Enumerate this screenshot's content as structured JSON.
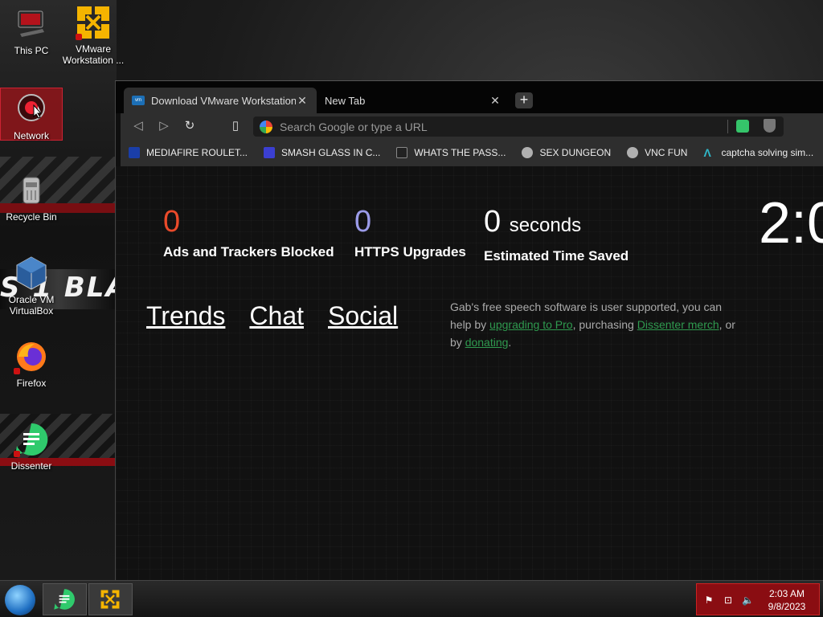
{
  "desktop": {
    "icons": [
      {
        "label": "This PC"
      },
      {
        "label": "VMware Workstation ..."
      },
      {
        "label": "Network"
      },
      {
        "label": "Recycle Bin"
      },
      {
        "label": "Oracle VM VirtualBox"
      },
      {
        "label": "Firefox"
      },
      {
        "label": "Dissenter"
      }
    ],
    "wallpaper_text": "S 1 BLA"
  },
  "browser": {
    "tabs": [
      {
        "title": "Download VMware Workstation Pl",
        "active": true
      },
      {
        "title": "New Tab",
        "active": false
      }
    ],
    "new_tab": "+",
    "urlbar_placeholder": "Search Google or type a URL",
    "bookmarks": [
      {
        "label": "MEDIAFIRE ROULET...",
        "icon_color": "#1a3ea8"
      },
      {
        "label": "SMASH GLASS IN C...",
        "icon_color": "#3b3fd1"
      },
      {
        "label": "WHATS THE PASS...",
        "icon_color": "#222222"
      },
      {
        "label": "SEX DUNGEON",
        "icon_color": "#b0b0b0"
      },
      {
        "label": "VNC FUN",
        "icon_color": "#b0b0b0"
      },
      {
        "label": "captcha solving sim...",
        "icon_color": "#2fb8c9"
      }
    ]
  },
  "newtab": {
    "stats": [
      {
        "value": "0",
        "unit": "",
        "label": "Ads and Trackers Blocked",
        "color": "#ea4a2a"
      },
      {
        "value": "0",
        "unit": "",
        "label": "HTTPS Upgrades",
        "color": "#9b9be8"
      },
      {
        "value": "0",
        "unit": "seconds",
        "label": "Estimated Time Saved",
        "color": "#ffffff"
      }
    ],
    "clock": "2:0",
    "links": [
      "Trends",
      "Chat",
      "Social"
    ],
    "support": {
      "t1": "Gab's free speech software is user supported, you can help by ",
      "l1": "upgrading to Pro",
      "t2": ", purchasing ",
      "l2": "Dissenter merch",
      "t3": ", or by ",
      "l3": "donating",
      "t4": "."
    }
  },
  "taskbar": {
    "time": "2:03 AM",
    "date": "9/8/2023"
  }
}
